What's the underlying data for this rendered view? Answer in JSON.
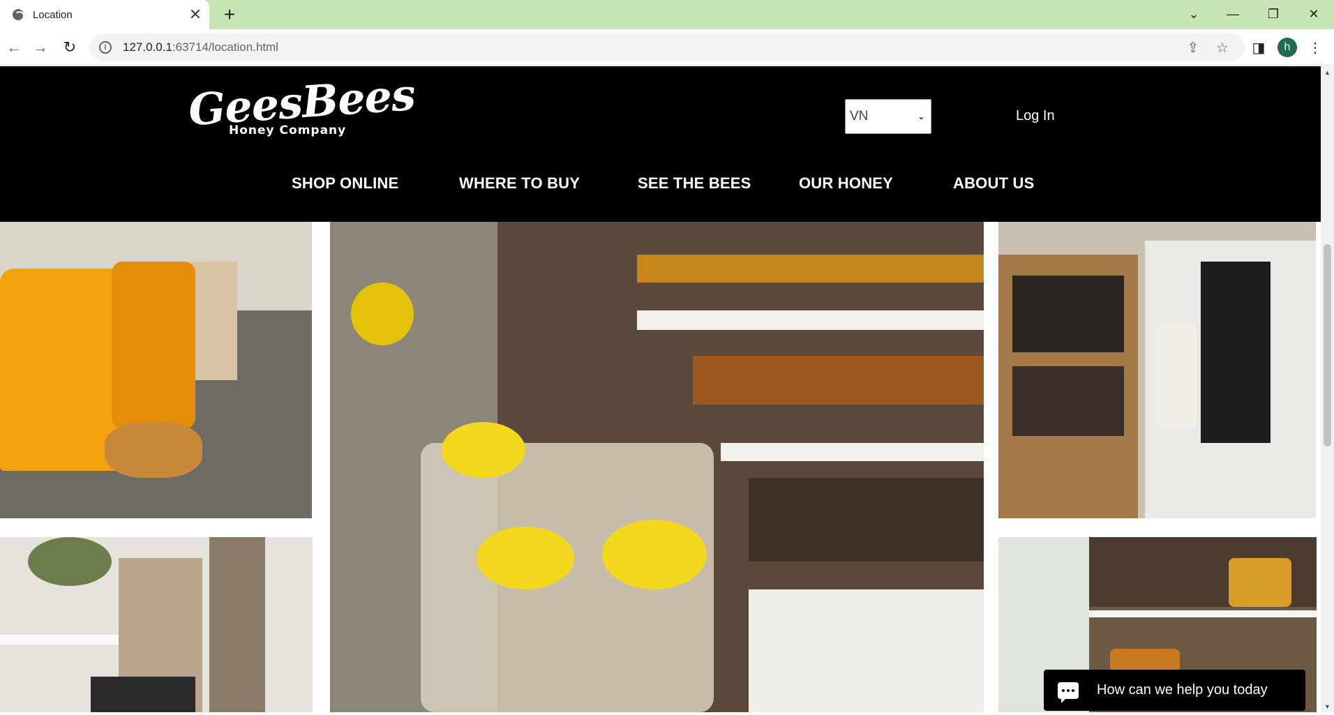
{
  "browser": {
    "tab_title": "Location",
    "url_host": "127.0.0.1",
    "url_rest": ":63714/location.html",
    "profile_initial": "h",
    "tabstrip_color": "#c6e4b4"
  },
  "site": {
    "logo_script": "GeesBees",
    "logo_sub": "Honey Company",
    "language": "VN",
    "login_label": "Log In",
    "nav": [
      {
        "label": "SHOP ONLINE"
      },
      {
        "label": "WHERE TO BUY"
      },
      {
        "label": "SEE THE BEES"
      },
      {
        "label": "OUR HONEY"
      },
      {
        "label": "ABOUT US"
      }
    ]
  },
  "gallery": [
    {
      "name": "photo-shirts",
      "subject": "honey-colored GeesBees t-shirts on a rack"
    },
    {
      "name": "photo-honey-display",
      "subject": "honey jars on shelves with gift baskets"
    },
    {
      "name": "photo-shelves",
      "subject": "wooden shelves with honey jars and umbrellas"
    },
    {
      "name": "photo-decor",
      "subject": "shop decor with plants and beehive"
    },
    {
      "name": "photo-wall",
      "subject": "wall shelves with honeycomb decor"
    }
  ],
  "chat": {
    "label": "How can we help you today"
  }
}
